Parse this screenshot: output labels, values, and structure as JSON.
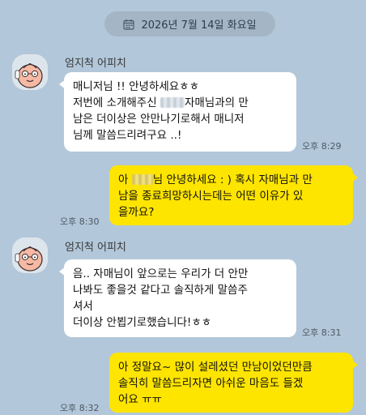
{
  "date_header": {
    "text": "2026년 7월 14일 화요일",
    "icon": "calendar-icon"
  },
  "colors": {
    "background": "#b2c7d9",
    "outgoing_bubble": "#fee500",
    "incoming_bubble": "#ffffff"
  },
  "messages": [
    {
      "direction": "in",
      "sender": "엄지척 어피치",
      "lines": [
        "매니저님 !! 안녕하세요ㅎㅎ",
        "저번에 소개해주신",
        "자매님과의 만",
        "남은 더이상은 안만나기로해서 매니저",
        "님께 말씀드리려구요 ..!"
      ],
      "time": "오후 8:29"
    },
    {
      "direction": "out",
      "lines": [
        "아",
        "님 안녕하세요 : ) 혹시 자매님과 만",
        "남을 종료희망하시는데는 어떤 이유가 있",
        "을까요?"
      ],
      "time": "오후 8:30"
    },
    {
      "direction": "in",
      "sender": "엄지척 어피치",
      "lines": [
        "음.. 자매님이 앞으로는 우리가 더 안만",
        "나봐도 좋을것 같다고 솔직하게 말씀주",
        "셔서",
        "더이상 안뵙기로했습니다!ㅎㅎ"
      ],
      "time": "오후 8:31"
    },
    {
      "direction": "out",
      "lines": [
        "아 정말요~ 많이 설레셨던 만남이었던만큼",
        " 솔직히 말씀드리자면 아쉬운 마음도 들겠",
        "어요 ㅠㅠ"
      ],
      "time": "오후 8:32"
    }
  ]
}
